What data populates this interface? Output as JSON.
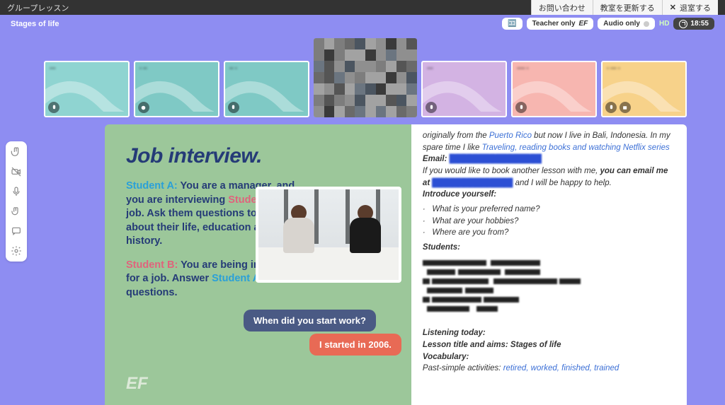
{
  "topbar": {
    "title": "グループレッスン",
    "contact": "お問い合わせ",
    "refresh": "教室を更新する",
    "exit": "退室する"
  },
  "secbar": {
    "lesson_title": "Stages of life",
    "teacher_only": "Teacher only",
    "ef_badge": "EF",
    "audio_only": "Audio only",
    "hd_label": "HD",
    "timer": "18:55"
  },
  "slide": {
    "title": "Job interview.",
    "sA_label": "Student A:",
    "sA_text": " You are a manager, and you are interviewing ",
    "sB_inline": "Student B",
    "sA_text2": " for a job. Ask them questions to find out about their life, education and work history.",
    "sB_label": "Student B:",
    "sB_text": " You are being interviewed for a job. Answer ",
    "sA_inline": "Student A",
    "sB_text2": "'s questions.",
    "logo": "EF",
    "bubble_q": "When did you start work?",
    "bubble_a": "I started in 2006."
  },
  "notes": {
    "intro1_a": "originally from the ",
    "intro1_link1": "Puerto Rico",
    "intro1_b": " but now I live in Bali, Indonesia. In my spare time I like ",
    "intro1_link2": "Traveling, reading books and watching Netflix series",
    "email_label": "Email:",
    "book1": "If you would like to book another lesson with me, ",
    "book_bold": "you can email me at ",
    "book2": " and I will be happy to help.",
    "introduce": "Introduce yourself:",
    "q1": "What is your preferred name?",
    "q2": "What are your hobbies?",
    "q3": "Where are you from?",
    "students_label": "Students:",
    "listening": "Listening today:",
    "lesson_title_line": "Lesson title and aims: Stages of life",
    "vocab_label": "Vocabulary:",
    "past_simple": "Past-simple activities: ",
    "past_words": "retired, worked, finished, trained"
  }
}
